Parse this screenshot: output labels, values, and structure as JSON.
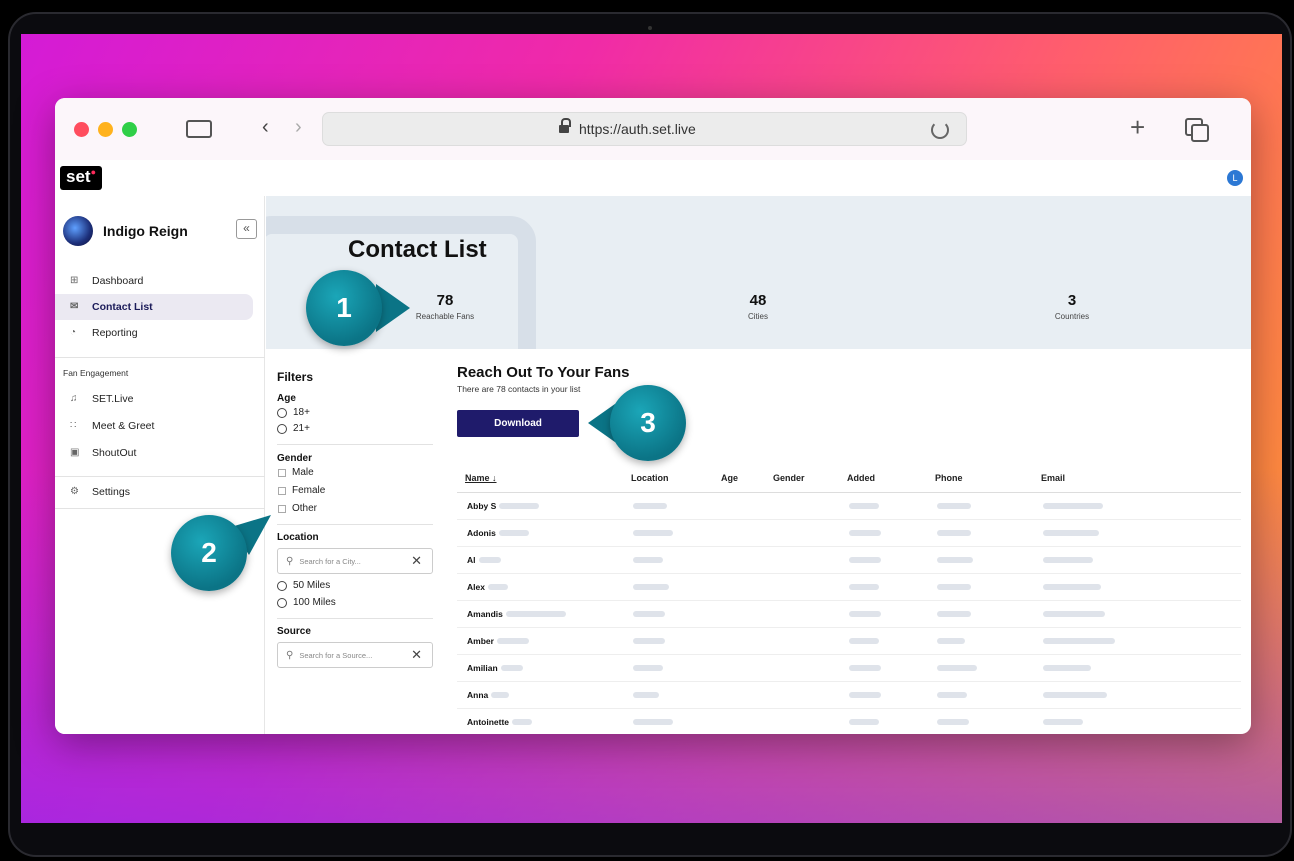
{
  "browser": {
    "url": "https://auth.set.live"
  },
  "app": {
    "logo": "set",
    "user_initial": "L"
  },
  "sidebar": {
    "artist_name": "Indigo Reign",
    "collapse_label": "«",
    "items": [
      {
        "label": "Dashboard",
        "icon": "dashboard-icon"
      },
      {
        "label": "Contact List",
        "icon": "mail-icon",
        "active": true
      },
      {
        "label": "Reporting",
        "icon": "reporting-icon"
      }
    ],
    "section_label": "Fan Engagement",
    "engagement_items": [
      {
        "label": "SET.Live",
        "icon": "music-icon"
      },
      {
        "label": "Meet & Greet",
        "icon": "people-icon"
      },
      {
        "label": "ShoutOut",
        "icon": "shoutout-icon"
      }
    ],
    "settings_label": "Settings"
  },
  "banner": {
    "title": "Contact List",
    "stats": [
      {
        "value": "78",
        "label": "Reachable Fans"
      },
      {
        "value": "48",
        "label": "Cities"
      },
      {
        "value": "3",
        "label": "Countries"
      }
    ]
  },
  "filters": {
    "title": "Filters",
    "age_label": "Age",
    "age_options": [
      "18+",
      "21+"
    ],
    "gender_label": "Gender",
    "gender_options": [
      "Male",
      "Female",
      "Other"
    ],
    "location_label": "Location",
    "location_placeholder": "Search for a City...",
    "distance_options": [
      "50 Miles",
      "100 Miles"
    ],
    "source_label": "Source",
    "source_placeholder": "Search for a Source..."
  },
  "main": {
    "title": "Reach Out To Your Fans",
    "subtitle": "There are 78 contacts in your list",
    "download_label": "Download",
    "columns": [
      "Name ↓",
      "Location",
      "Age",
      "Gender",
      "Added",
      "Phone",
      "Email"
    ],
    "rows": [
      "Abby S",
      "Adonis",
      "Al",
      "Alex",
      "Amandis",
      "Amber",
      "Amilian",
      "Anna",
      "Antoinette"
    ]
  },
  "callouts": [
    "1",
    "2",
    "3"
  ],
  "colors": {
    "accent": "#1f1b6b",
    "callout": "#0b7486"
  }
}
